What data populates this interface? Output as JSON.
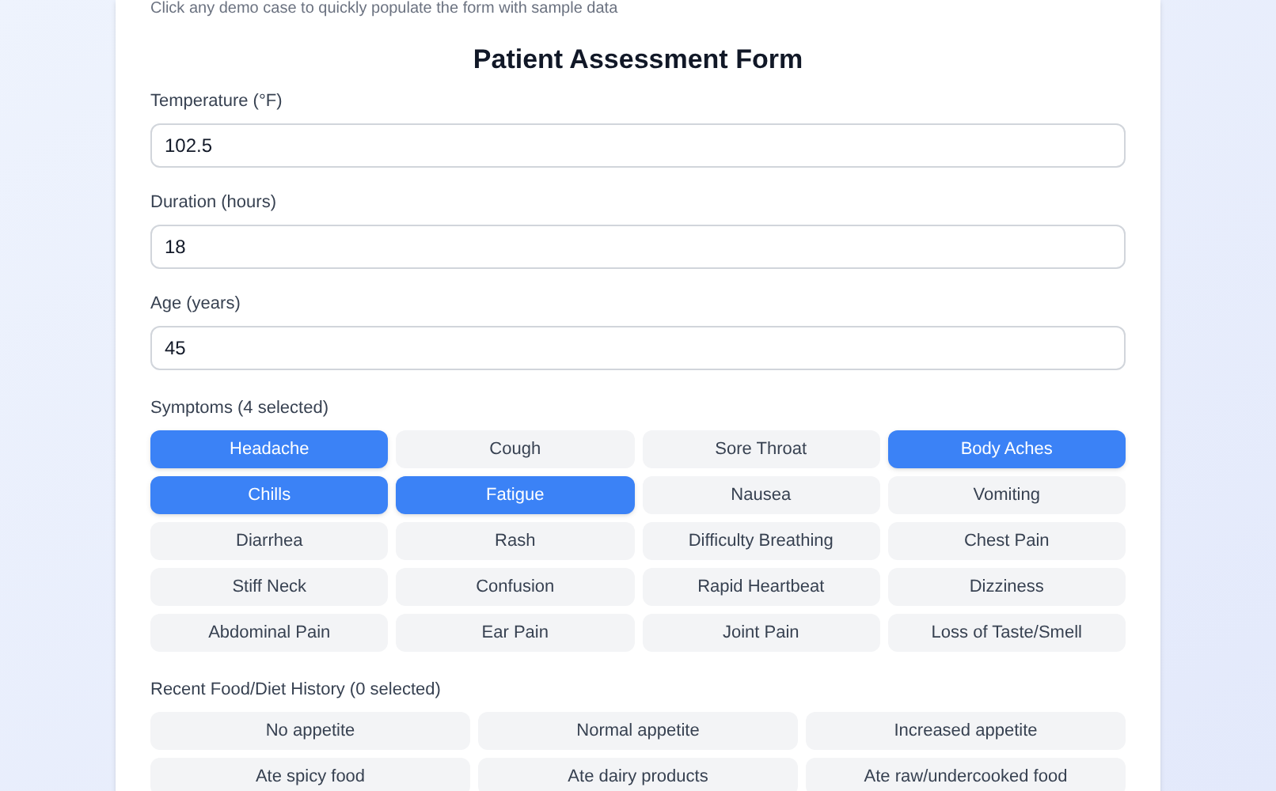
{
  "hint": "Click any demo case to quickly populate the form with sample data",
  "form": {
    "title": "Patient Assessment Form",
    "fields": [
      {
        "label": "Temperature (°F)",
        "value": "102.5"
      },
      {
        "label": "Duration (hours)",
        "value": "18"
      },
      {
        "label": "Age (years)",
        "value": "45"
      }
    ],
    "symptoms": {
      "label": "Symptoms (4 selected)",
      "options": [
        {
          "label": "Headache",
          "selected": true
        },
        {
          "label": "Cough",
          "selected": false
        },
        {
          "label": "Sore Throat",
          "selected": false
        },
        {
          "label": "Body Aches",
          "selected": true
        },
        {
          "label": "Chills",
          "selected": true
        },
        {
          "label": "Fatigue",
          "selected": true
        },
        {
          "label": "Nausea",
          "selected": false
        },
        {
          "label": "Vomiting",
          "selected": false
        },
        {
          "label": "Diarrhea",
          "selected": false
        },
        {
          "label": "Rash",
          "selected": false
        },
        {
          "label": "Difficulty Breathing",
          "selected": false
        },
        {
          "label": "Chest Pain",
          "selected": false
        },
        {
          "label": "Stiff Neck",
          "selected": false
        },
        {
          "label": "Confusion",
          "selected": false
        },
        {
          "label": "Rapid Heartbeat",
          "selected": false
        },
        {
          "label": "Dizziness",
          "selected": false
        },
        {
          "label": "Abdominal Pain",
          "selected": false
        },
        {
          "label": "Ear Pain",
          "selected": false
        },
        {
          "label": "Joint Pain",
          "selected": false
        },
        {
          "label": "Loss of Taste/Smell",
          "selected": false
        }
      ]
    },
    "diet": {
      "label": "Recent Food/Diet History (0 selected)",
      "options": [
        {
          "label": "No appetite",
          "selected": false
        },
        {
          "label": "Normal appetite",
          "selected": false
        },
        {
          "label": "Increased appetite",
          "selected": false
        },
        {
          "label": "Ate spicy food",
          "selected": false
        },
        {
          "label": "Ate dairy products",
          "selected": false
        },
        {
          "label": "Ate raw/undercooked food",
          "selected": false
        }
      ]
    }
  }
}
